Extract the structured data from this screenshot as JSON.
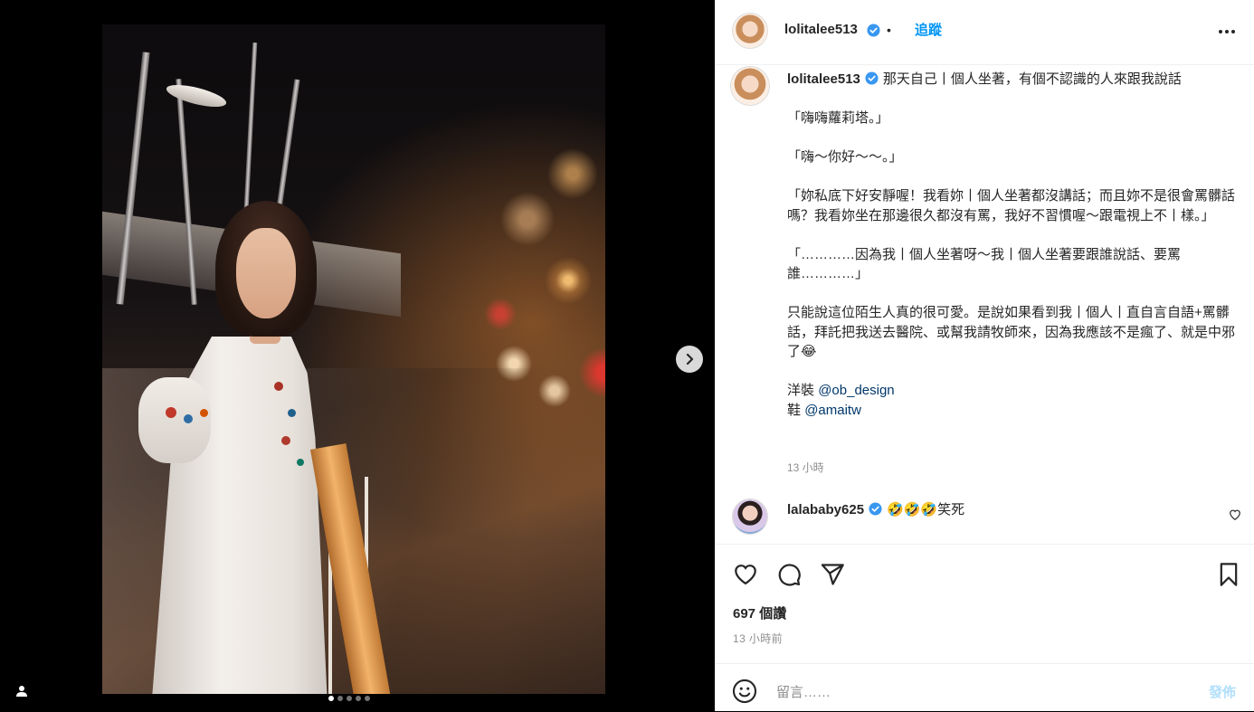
{
  "header": {
    "username": "lolitalee513",
    "separator": "•",
    "follow_label": "追蹤",
    "more_icon": "more-horizontal-icon"
  },
  "carousel": {
    "slide_count": 5,
    "active_index": 0,
    "next_icon": "chevron-right-icon",
    "tag_icon": "user-tag-icon"
  },
  "caption": {
    "username": "lolitalee513",
    "text_first_line": "那天自己丨個人坐著，有個不認識的人來跟我說話",
    "body": "「嗨嗨蘿莉塔。」\n\n「嗨～你好～～。」\n\n「妳私底下好安靜喔！我看妳丨個人坐著都沒講話；而且妳不是很會罵髒話嗎？我看妳坐在那邊很久都沒有罵，我好不習慣喔～跟電視上不丨樣。」\n\n「…………因為我丨個人坐著呀～我丨個人坐著要跟誰說話、要罵誰…………」\n\n只能說這位陌生人真的很可愛。是說如果看到我丨個人丨直自言自語+罵髒話，拜託把我送去醫院、或幫我請牧師來，因為我應該不是瘋了、就是中邪了😂",
    "dress_label": "洋裝",
    "dress_mention": "@ob_design",
    "shoes_label": "鞋",
    "shoes_mention": "@amaitw",
    "time": "13 小時"
  },
  "comment": {
    "username": "lalababy625",
    "text": "🤣🤣🤣笑死",
    "like_icon": "heart-outline-icon"
  },
  "actions": {
    "like_icon": "heart-outline-icon",
    "comment_icon": "comment-bubble-icon",
    "share_icon": "paper-plane-icon",
    "save_icon": "bookmark-icon"
  },
  "likes_text": "697 個讚",
  "post_time": "13 小時前",
  "comment_bar": {
    "emoji_icon": "smiley-icon",
    "placeholder": "留言……",
    "post_label": "發佈"
  },
  "colors": {
    "link_blue": "#0095f6",
    "mention_blue": "#00376b",
    "post_button_disabled": "#b2dffc",
    "verified_blue": "#3897f0"
  }
}
